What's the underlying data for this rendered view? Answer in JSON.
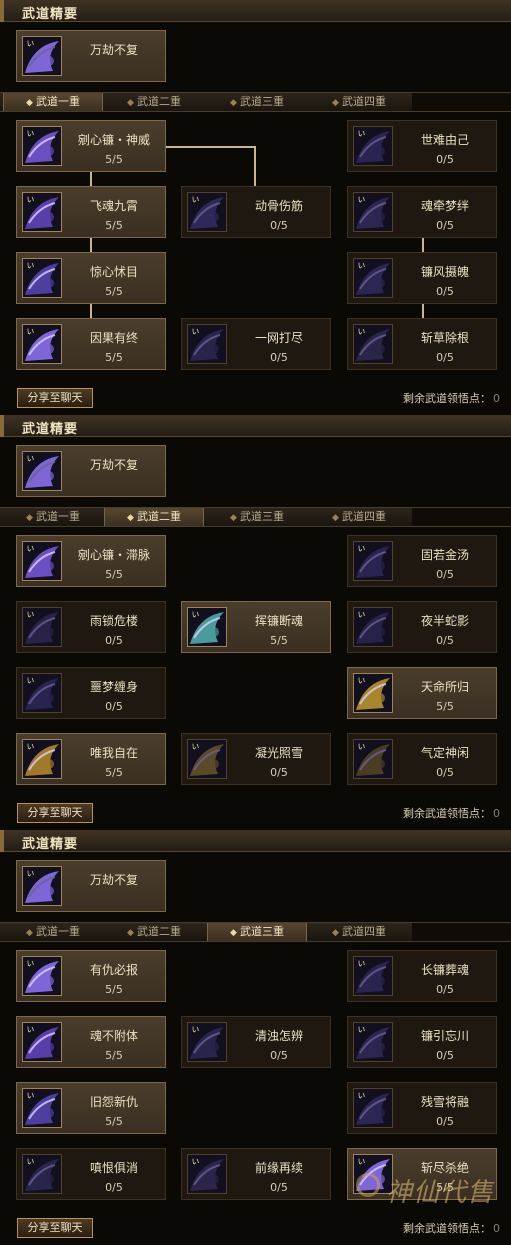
{
  "panels": [
    {
      "section_title": "武道精要",
      "mastery": {
        "name": "万劫不复",
        "icon": "purple-wave-icon"
      },
      "tabs": [
        "武道一重",
        "武道二重",
        "武道三重",
        "武道四重"
      ],
      "active_tab": 0,
      "skills": [
        {
          "name": "剜心镰・神威",
          "level": "5/5",
          "lit": true,
          "icon": "scythe-slash-icon",
          "col": 0,
          "row": 0
        },
        {
          "name": "世难由己",
          "level": "0/5",
          "lit": false,
          "icon": "dark-shroud-icon",
          "col": 2,
          "row": 0
        },
        {
          "name": "飞魂九霄",
          "level": "5/5",
          "lit": true,
          "icon": "purple-spirit-icon",
          "col": 0,
          "row": 1
        },
        {
          "name": "动骨伤筋",
          "level": "0/5",
          "lit": false,
          "icon": "shadow-claw-icon",
          "col": 1,
          "row": 1
        },
        {
          "name": "魂牵梦绊",
          "level": "0/5",
          "lit": false,
          "icon": "dark-ghost-icon",
          "col": 2,
          "row": 1
        },
        {
          "name": "惊心怵目",
          "level": "5/5",
          "lit": true,
          "icon": "moon-scythe-icon",
          "col": 0,
          "row": 2
        },
        {
          "name": "镰风摄魄",
          "level": "0/5",
          "lit": false,
          "icon": "dark-wind-icon",
          "col": 2,
          "row": 2
        },
        {
          "name": "因果有终",
          "level": "5/5",
          "lit": true,
          "icon": "purple-wave-icon",
          "col": 0,
          "row": 3
        },
        {
          "name": "一网打尽",
          "level": "0/5",
          "lit": false,
          "icon": "dark-net-icon",
          "col": 1,
          "row": 3
        },
        {
          "name": "斩草除根",
          "level": "0/5",
          "lit": false,
          "icon": "dark-blade-icon",
          "col": 2,
          "row": 3
        }
      ],
      "share_label": "分享至聊天",
      "remaining_label": "剩余武道领悟点：",
      "remaining_value": "0"
    },
    {
      "section_title": "武道精要",
      "mastery": {
        "name": "万劫不复",
        "icon": "purple-wave-icon"
      },
      "tabs": [
        "武道一重",
        "武道二重",
        "武道三重",
        "武道四重"
      ],
      "active_tab": 1,
      "skills": [
        {
          "name": "剜心镰・滞脉",
          "level": "5/5",
          "lit": true,
          "icon": "scythe-slash-icon",
          "col": 0,
          "row": 0
        },
        {
          "name": "固若金汤",
          "level": "0/5",
          "lit": false,
          "icon": "dark-shroud-icon",
          "col": 2,
          "row": 0
        },
        {
          "name": "雨锁危楼",
          "level": "0/5",
          "lit": false,
          "icon": "dark-spirit-icon",
          "col": 0,
          "row": 1
        },
        {
          "name": "挥镰断魂",
          "level": "5/5",
          "lit": true,
          "icon": "teal-ghost-icon",
          "col": 1,
          "row": 1
        },
        {
          "name": "夜半蛇影",
          "level": "0/5",
          "lit": false,
          "icon": "dark-snake-icon",
          "col": 2,
          "row": 1
        },
        {
          "name": "噩梦缠身",
          "level": "0/5",
          "lit": false,
          "icon": "dark-scythe-icon",
          "col": 0,
          "row": 2
        },
        {
          "name": "天命所归",
          "level": "5/5",
          "lit": true,
          "icon": "golden-flame-icon",
          "col": 2,
          "row": 2
        },
        {
          "name": "唯我自在",
          "level": "5/5",
          "lit": true,
          "icon": "golden-figure-icon",
          "col": 0,
          "row": 3
        },
        {
          "name": "凝光照雪",
          "level": "0/5",
          "lit": false,
          "icon": "dim-gold-icon",
          "col": 1,
          "row": 3
        },
        {
          "name": "气定神闲",
          "level": "0/5",
          "lit": false,
          "icon": "dim-vortex-icon",
          "col": 2,
          "row": 3
        }
      ],
      "share_label": "分享至聊天",
      "remaining_label": "剩余武道领悟点：",
      "remaining_value": "0"
    },
    {
      "section_title": "武道精要",
      "mastery": {
        "name": "万劫不复",
        "icon": "purple-wave-icon"
      },
      "tabs": [
        "武道一重",
        "武道二重",
        "武道三重",
        "武道四重"
      ],
      "active_tab": 2,
      "skills": [
        {
          "name": "有仇必报",
          "level": "5/5",
          "lit": true,
          "icon": "purple-wave-icon",
          "col": 0,
          "row": 0
        },
        {
          "name": "长镰葬魂",
          "level": "0/5",
          "lit": false,
          "icon": "dark-shroud-icon",
          "col": 2,
          "row": 0
        },
        {
          "name": "魂不附体",
          "level": "5/5",
          "lit": true,
          "icon": "purple-spirit-icon",
          "col": 0,
          "row": 1
        },
        {
          "name": "清浊怎辨",
          "level": "0/5",
          "lit": false,
          "icon": "dark-net-icon",
          "col": 1,
          "row": 1
        },
        {
          "name": "镰引忘川",
          "level": "0/5",
          "lit": false,
          "icon": "dark-ghost-icon",
          "col": 2,
          "row": 1
        },
        {
          "name": "旧怨新仇",
          "level": "5/5",
          "lit": true,
          "icon": "moon-scythe-icon",
          "col": 0,
          "row": 2
        },
        {
          "name": "残雪将融",
          "level": "0/5",
          "lit": false,
          "icon": "dark-wind-icon",
          "col": 2,
          "row": 2
        },
        {
          "name": "嗔恨俱消",
          "level": "0/5",
          "lit": false,
          "icon": "dark-wave-icon",
          "col": 0,
          "row": 3
        },
        {
          "name": "前缘再续",
          "level": "0/5",
          "lit": false,
          "icon": "dark-blade-icon",
          "col": 1,
          "row": 3
        },
        {
          "name": "斩尽杀绝",
          "level": "5/5",
          "lit": true,
          "icon": "purple-wave-icon",
          "col": 2,
          "row": 3
        }
      ],
      "share_label": "分享至聊天",
      "remaining_label": "剩余武道领悟点：",
      "remaining_value": "0"
    }
  ],
  "icon_colors": {
    "purple-wave-icon": "#7f66d6",
    "scythe-slash-icon": "#6b4fc0",
    "purple-spirit-icon": "#5a3ea8",
    "moon-scythe-icon": "#4e3f9e",
    "shadow-claw-icon": "#2e2858",
    "dark-shroud-icon": "#2a2450",
    "dark-ghost-icon": "#2d2650",
    "dark-wind-icon": "#2c2652",
    "dark-net-icon": "#28244c",
    "dark-blade-icon": "#2a2549",
    "dark-spirit-icon": "#2b2248",
    "teal-ghost-icon": "#4b9a9a",
    "dark-snake-icon": "#262248",
    "dark-scythe-icon": "#292350",
    "golden-flame-icon": "#a8862e",
    "golden-figure-icon": "#a07a2a",
    "dim-gold-icon": "#5a4a2a",
    "dim-vortex-icon": "#4a3d26",
    "dark-wave-icon": "#29244c"
  },
  "watermark": "神仙代售"
}
